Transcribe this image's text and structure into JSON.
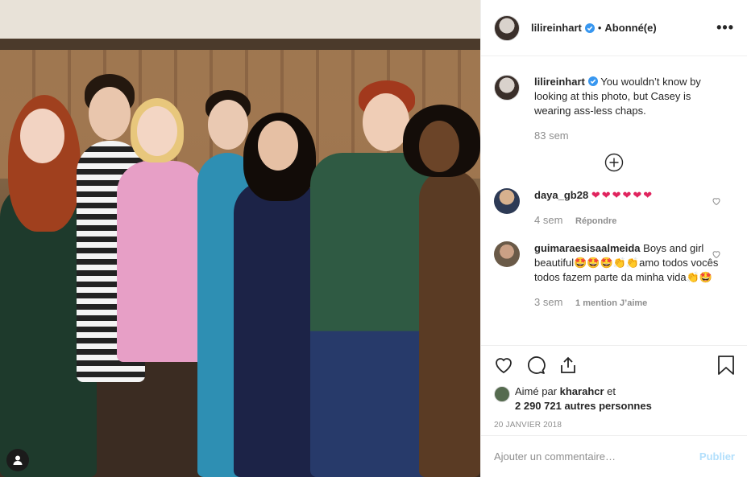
{
  "post_header": {
    "username": "lilireinhart",
    "separator": "•",
    "follow_status": "Abonné(e)",
    "more_icon": "more-horizontal-icon"
  },
  "caption": {
    "username": "lilireinhart",
    "text": "You wouldn’t know by looking at this photo, but Casey is wearing ass-less chaps.",
    "time": "83 sem"
  },
  "comments": [
    {
      "username": "daya_gb28",
      "text": "❤❤❤❤❤❤",
      "time": "4 sem",
      "reply_label": "Répondre"
    },
    {
      "username": "guimaraesisaalmeida",
      "text": "Boys and girl beautiful🤩🤩🤩👏👏amo todos vocês todos fazem parte da minha vida👏🤩",
      "time": "3 sem",
      "likes_label": "1 mention J’aime"
    }
  ],
  "likes": {
    "prefix": "Aimé par ",
    "user": "kharahcr",
    "suffix": " et",
    "others": "2 290 721 autres personnes"
  },
  "date": "20 JANVIER 2018",
  "add_comment": {
    "placeholder": "Ajouter un commentaire…",
    "publish_label": "Publier"
  },
  "colors": {
    "verified": "#3897f0",
    "heart": "#e0245e",
    "publish_disabled": "#b2dffc",
    "muted": "#8e8e8e"
  }
}
